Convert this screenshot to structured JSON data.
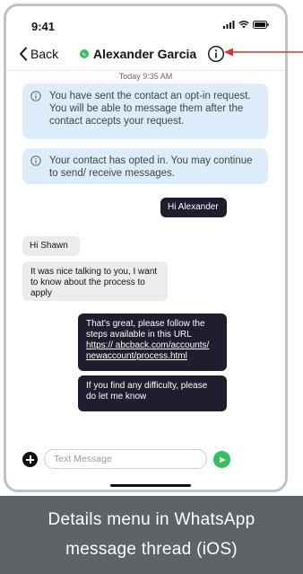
{
  "status_bar": {
    "time": "9:41"
  },
  "nav": {
    "back_label": "Back",
    "contact_name": "Alexander Garcia"
  },
  "thread": {
    "date_label": "Today 9:35 AM",
    "notices": [
      "You have sent the contact an opt-in request. You will be able to message them after the contact accepts your request.",
      "Your contact has opted in. You may continue to send/ receive messages."
    ],
    "messages": [
      {
        "direction": "outgoing",
        "text": "Hi Alexander"
      },
      {
        "direction": "incoming",
        "text": "Hi Shawn"
      },
      {
        "direction": "incoming",
        "text": "It was nice talking to you, I want to know about the process to apply"
      },
      {
        "direction": "outgoing",
        "text_before": "That's great, please follow the steps available in this URL",
        "link": "https:// abcback.com/accounts/ newaccount/process.html"
      },
      {
        "direction": "outgoing",
        "text": "If you find any difficulty, please do let me know"
      }
    ]
  },
  "input": {
    "placeholder": "Text Message"
  },
  "caption": {
    "line1": "Details menu in WhatsApp",
    "line2": "message thread (iOS)"
  },
  "colors": {
    "whatsapp_green": "#35c05c",
    "notice_bg": "#dcecfa",
    "outgoing_bg": "#1e1e2e",
    "incoming_bg": "#ececec",
    "arrow_red": "#d9342b",
    "caption_bg": "#5e6367"
  },
  "icons": [
    "signal-icon",
    "wifi-icon",
    "battery-icon",
    "chevron-left-icon",
    "whatsapp-icon",
    "info-icon",
    "plus-icon",
    "send-icon"
  ]
}
